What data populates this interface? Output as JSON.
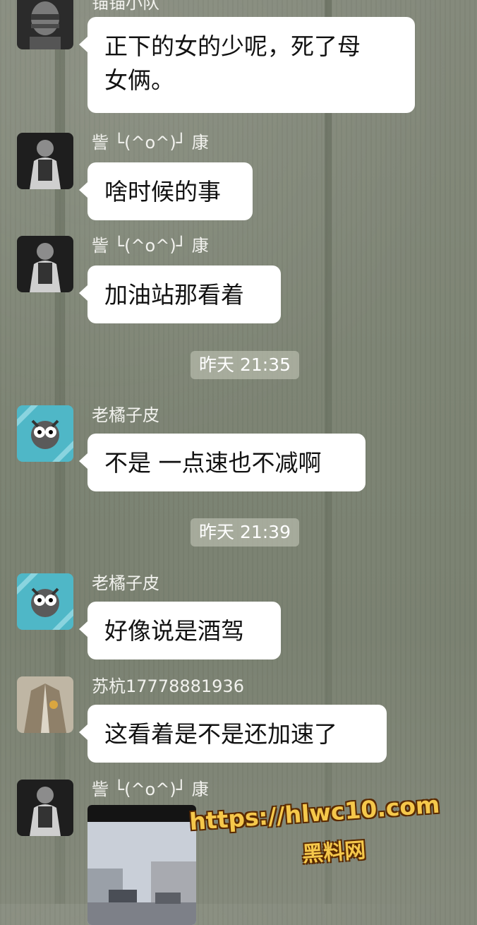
{
  "messages": [
    {
      "sender": "锚锚小队",
      "text": "正下的女的少呢，死了母\n女俩。",
      "avatar": "masked-face-avatar"
    },
    {
      "sender": "訾 └(^o^)┘ 康",
      "text": "啥时候的事",
      "avatar": "seated-man-avatar"
    },
    {
      "sender": "訾 └(^o^)┘ 康",
      "text": "加油站那看着",
      "avatar": "seated-man-avatar"
    },
    {
      "sender": "老橘子皮",
      "text": "不是 一点速也不减啊",
      "avatar": "cartoon-wolf-avatar"
    },
    {
      "sender": "老橘子皮",
      "text": "好像说是酒驾",
      "avatar": "cartoon-wolf-avatar"
    },
    {
      "sender": "苏杭17778881936",
      "text": "这看着是不是还加速了",
      "avatar": "coat-avatar"
    },
    {
      "sender": "訾 └(^o^)┘ 康",
      "text": "",
      "avatar": "seated-man-avatar"
    }
  ],
  "timestamps": [
    "昨天 21:35",
    "昨天 21:39"
  ],
  "watermark": {
    "url": "https://hlwc10.com",
    "name": "黑料网"
  },
  "colors": {
    "bubble": "#ffffff",
    "background": "#7e8575",
    "watermark": "#f5c84b"
  }
}
